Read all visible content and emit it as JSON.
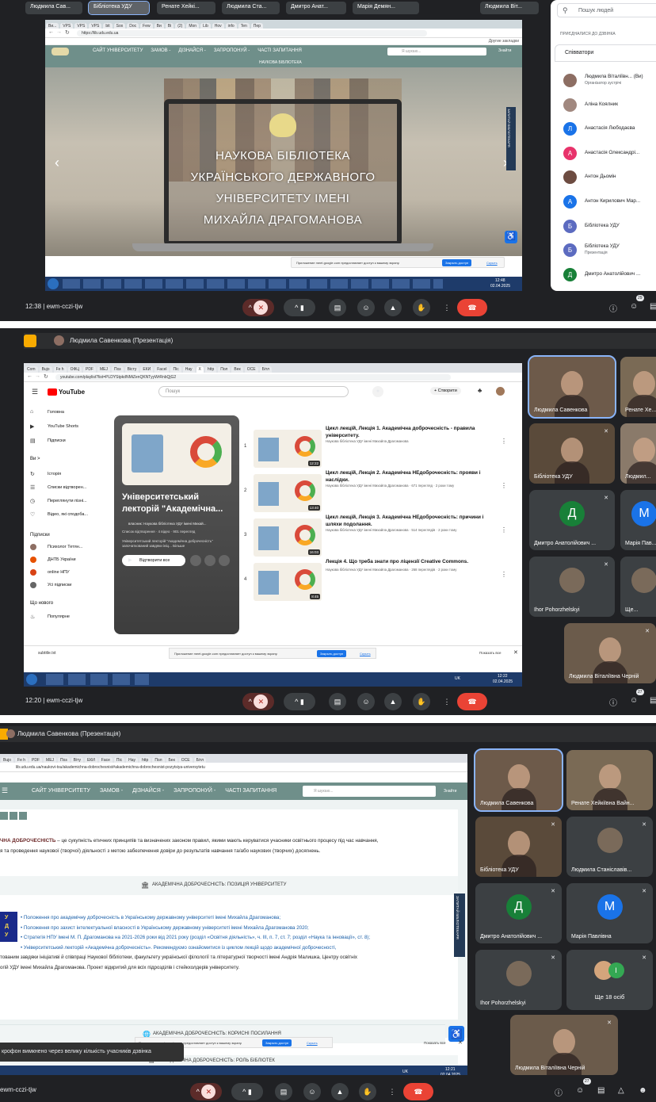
{
  "call": {
    "meeting_code": "ewm-cczi-tjw",
    "people_count_1": "29",
    "people_count_2": "27",
    "people_count_3": "27"
  },
  "section1": {
    "time": "12:38",
    "chips": [
      "Людмила Сав...",
      "Бібліотека УДУ",
      "Ренате Хейкі...",
      "Людмила Ста...",
      "Дмитро Анат...",
      "Марія Демян...",
      "Людмила Віт..."
    ],
    "active_chip_index": 1,
    "browser": {
      "url": "https://lib.udu.edu.ua",
      "others_label": "Другие закладки",
      "nav_items": [
        "САЙТ УНІВЕРСИТЕТУ",
        "ЗАМОВ -",
        "ДІЗНАЙСЯ -",
        "ЗАПРОПОНУЙ -",
        "ЧАСТІ ЗАПИТАННЯ"
      ],
      "search_placeholder": "Я шукаю...",
      "search_button": "Знайти",
      "small_label": "НАУКОВА БІБЛІОТЕКА",
      "hero_lines": [
        "НАУКОВА БІБЛІОТЕКА",
        "УКРАЇНСЬКОГО ДЕРЖАВНОГО",
        "УНІВЕРСИТЕТУ ІМЕНІ",
        "МИХАЙЛА ДРАГОМАНОВА"
      ],
      "side_tab": "ЗАПИТАЙ БІБЛІОТЕКАРЯ",
      "share_notice": "Приложение meet.google.com предоставляет доступ к вашему экрану.",
      "share_stop": "Закрыть доступ",
      "share_hide": "Скрыть",
      "clock_time": "12:48",
      "clock_date": "02.04.2025"
    },
    "people_panel": {
      "search_placeholder": "Пошук людей",
      "joined_label": "ПРИЄДНАЛИСЯ ДО ДЗВІНКА",
      "group_label": "Співватори",
      "people": [
        {
          "name": "Людмила Віталіївн... (Ви)",
          "role": "Організатор зустрічі",
          "initial": "",
          "color": "#8d6e63"
        },
        {
          "name": "Аліна Коялник",
          "role": "",
          "initial": "",
          "color": "#a1887f"
        },
        {
          "name": "Анастасія Любодаєва",
          "role": "",
          "initial": "Л",
          "color": "#1a73e8"
        },
        {
          "name": "Анастасія Олександрі...",
          "role": "",
          "initial": "А",
          "color": "#e8336b"
        },
        {
          "name": "Антон Дьомін",
          "role": "",
          "initial": "",
          "color": "#6d4c41"
        },
        {
          "name": "Антон Кирилович Мар...",
          "role": "",
          "initial": "А",
          "color": "#1a73e8"
        },
        {
          "name": "Бібліотека УДУ",
          "role": "",
          "initial": "Б",
          "color": "#5c6bc0"
        },
        {
          "name": "Бібліотека УДУ",
          "role": "Презентація",
          "initial": "Б",
          "color": "#5c6bc0"
        },
        {
          "name": "Дмитро Анатолійович ...",
          "role": "",
          "initial": "Д",
          "color": "#188038"
        }
      ]
    }
  },
  "section2": {
    "time": "12:20",
    "presenter_label": "Людмила Савенкова (Презентація)",
    "youtube": {
      "url": "youtube.com/playlist?list=PLDYStpkdNMiZenQKNTyyWrRnbQjG2",
      "logo": "YouTube",
      "search_placeholder": "Пошук",
      "create_label": "+ Створити",
      "sidebar_main": [
        "Головна",
        "YouTube Shorts",
        "Підписки"
      ],
      "you_header": "Ви >",
      "you_items": [
        "Історія",
        "Списки відтворен...",
        "Переглянути пізні...",
        "Відео, які сподоба..."
      ],
      "subs_header": "Підписки",
      "subs": [
        "Психолог Тетян...",
        "ДНТБ України",
        "online НПУ",
        "Усі підписки"
      ],
      "new_header": "Що нового",
      "new_items": [
        "Популярне"
      ],
      "playlist_title": "Університетський лекторій \"Академічна...",
      "playlist_owner": "власник: Наукова бібліотека УДУ імені Михай...",
      "playlist_meta": "Список відтворення · 4 відео · 901 перегляд",
      "playlist_desc": "Університетський лекторій \"Академічна доброчесність\" започаткований завдяки ініц... Більше",
      "play_all": "Відтворити все",
      "videos": [
        {
          "n": "1",
          "title": "Цикл лекцій, Лекція 1. Академічна доброчесність - правила університету.",
          "meta": "Наукова бібліотека УДУ імені Михайла Драгоманова",
          "dur": "12:22"
        },
        {
          "n": "2",
          "title": "Цикл лекцій, Лекція 2. Академічна НЕдоброчесність: прояви і наслідки.",
          "meta": "Наукова бібліотека УДУ імені Михайла Драгоманова · 671 перегляд · 2 роки тому",
          "dur": "13:40"
        },
        {
          "n": "3",
          "title": "Цикл лекцій, Лекція 3. Академічна НЕдоброчесність: причини і шляхи подолання.",
          "meta": "Наукова бібліотека УДУ імені Михайла Драгоманова · 514 переглядів · 2 роки тому",
          "dur": "16:03"
        },
        {
          "n": "4",
          "title": "Лекція 4. Що треба знати про ліцензії Creative Commons.",
          "meta": "Наукова бібліотека УДУ імені Михайла Драгоманова · 268 переглядів · 2 роки тому",
          "dur": "8:45"
        }
      ],
      "download": "subtitle.txt",
      "share_notice": "Приложение meet.google.com предоставляет доступ к вашему экрану.",
      "share_stop": "Закрыть доступ",
      "share_hide": "Скрыть",
      "show_all": "Показать все",
      "clock_time": "12:22",
      "clock_date": "02.04.2025",
      "lang": "UK"
    },
    "tiles": [
      {
        "name": "Людмила Савенкова",
        "kind": "video",
        "color": "#6d5a4a"
      },
      {
        "name": "Ренате Хе...",
        "kind": "video",
        "color": "#7a6a55"
      },
      {
        "name": "Бібліотека УДУ",
        "kind": "video",
        "color": "#5a4a3a"
      },
      {
        "name": "Людмил...",
        "kind": "video",
        "color": "#8a7a6a"
      },
      {
        "name": "Дмитро Анатолійович ...",
        "kind": "avatar",
        "initial": "Д",
        "color": "#188038"
      },
      {
        "name": "Марія Пав...",
        "kind": "avatar",
        "initial": "М",
        "color": "#1a73e8"
      },
      {
        "name": "Ihor Pohorzhelskyi",
        "kind": "photo",
        "color": "#3c4043"
      },
      {
        "name": "Ще...",
        "kind": "photo",
        "color": "#3c4043"
      },
      {
        "name": "Людмила Віталіївна Черній",
        "kind": "video",
        "color": "#6b5b4b"
      }
    ]
  },
  "section3": {
    "presenter_label": "Людмила Савенкова (Презентація)",
    "site": {
      "url": "lib.udu.edu.ua/naukovi-tsu/akademichna-dobrochesnist#akademichna-dobrochesnist-pozytsiya-universytetu",
      "nav_items": [
        "САЙТ УНІВЕРСИТЕТУ",
        "ЗАМОВ -",
        "ДІЗНАЙСЯ -",
        "ЗАПРОПОНУЙ -",
        "ЧАСТІ ЗАПИТАННЯ"
      ],
      "search_placeholder": "Я шукаю...",
      "search_button": "Знайти",
      "intro_bold": "ЧНА ДОБРОЧЕСНІСТЬ",
      "intro_rest": " – це сукупність етичних принципів та визначених законом правил, якими мають керуватися учасники освітнього процесу під час навчання,",
      "intro_line2": "я та проведення наукової (творчої) діяльності з метою забезпечення довіри до результатів навчання та/або наукових (творчих) досягнень.",
      "section_a": "АКАДЕМІЧНА ДОБРОЧЕСНІСТЬ: ПОЗИЦІЯ УНІВЕРСИТЕТУ",
      "links": [
        "Положення про академічну доброчесність в Українському державному університеті імені Михайла Драгоманова;",
        "Положення про захист інтелектуальної власності в Українському державному університеті імені Михайла Драгоманова 2020;",
        "Стратегія НПУ імені М. П. Драгоманова на 2021-2026 роки від 2021 року (розділ «Освітня діяльність», ч. III, п. 7, ст. 7; розділ «Наука та інновації», ст. 8);",
        "Університетський лекторій «Академічна доброчесність». Рекомендуємо ознайомитися із циклом лекцій щодо академічної доброчесності,"
      ],
      "link_cont1": "тованим завдяки ініціативі й співпраці Наукової бібліотеки, факультету української філології та літературної творчості імені Андрія Малишка, Центру освітніх",
      "link_cont2": "огій УДУ імені Михайла Драгоманова. Проект відкритий для всіх підрозділів і стейкхолдерів університету.",
      "section_b": "АКАДЕМІЧНА ДОБРОЧЕСНІСТЬ: КОРИСНІ ПОСИЛАННЯ",
      "section_c": "АКАДЕМІЧНА ДОБРОЧЕСНІСТЬ: РОЛЬ БІБЛІОТЕК",
      "side_tab": "ЗАПИТАЙ БІБЛІОТЕКАРЯ",
      "udu_letters": "У Д У",
      "share_notice": "Приложение meet.google.com предоставляет доступ к вашему экрану.",
      "share_stop": "Закрыть доступ",
      "share_hide": "Скрыть",
      "show_all": "Показать все",
      "clock_time": "12:21",
      "clock_date": "02.04.2025",
      "lang": "UK"
    },
    "toast": "крофон вимкнено через велику кількість учасників дзвінка",
    "tiles": [
      {
        "name": "Людмила Савенкова",
        "kind": "video",
        "color": "#6d5a4a"
      },
      {
        "name": "Ренате Хейкіївна Вайн...",
        "kind": "video",
        "color": "#7a6a55"
      },
      {
        "name": "Бібліотека УДУ",
        "kind": "video",
        "color": "#5a4a3a"
      },
      {
        "name": "Людмила Станіславів...",
        "kind": "photo",
        "color": "#3c4043"
      },
      {
        "name": "Дмитро Анатолійович ...",
        "kind": "avatar",
        "initial": "Д",
        "color": "#188038"
      },
      {
        "name": "Марія Павлівна",
        "kind": "avatar",
        "initial": "М",
        "color": "#1a73e8"
      },
      {
        "name": "Ihor Pohorzhelskyi",
        "kind": "photo",
        "color": "#3c4043"
      },
      {
        "name": "Ще 18 осіб",
        "kind": "more",
        "color": "#3c4043"
      },
      {
        "name": "Людмила Віталіївна Черній",
        "kind": "video",
        "color": "#6b5b4b"
      }
    ]
  }
}
